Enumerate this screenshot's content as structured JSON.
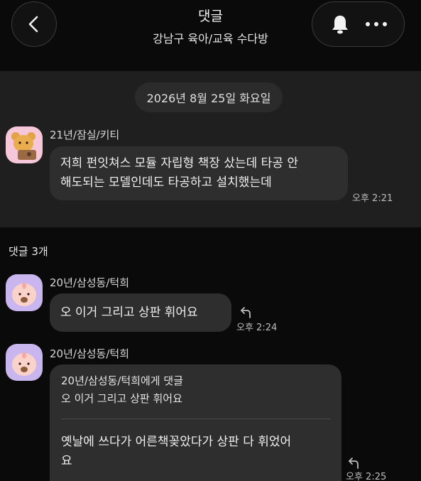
{
  "header": {
    "title": "댓글",
    "subtitle": "강남구 육아/교육 수다방",
    "icons": [
      "chevron-left-icon",
      "bell-icon",
      "more-icon"
    ]
  },
  "post": {
    "date": "2026년 8월 25일 화요일",
    "author": "21년/잠실/키티",
    "text_line1": "저희 펀잇쳐스 모듈 자립형 책장 샀는데 타공 안",
    "text_line2": "해도되는 모델인데도 타공하고 설치했는데",
    "time": "오후 2:21"
  },
  "comments_label": "댓글 3개",
  "comments": [
    {
      "author": "20년/삼성동/턱희",
      "text": "오 이거 그리고 상판 휘어요",
      "time": "오후 2:24"
    },
    {
      "author": "20년/삼성동/턱희",
      "quote_header": "20년/삼성동/턱희에게 댓글",
      "quote_text": "오 이거 그리고 상판 휘어요",
      "text_line1": "옛날에 쓰다가 어른책꽂았다가 상판 다 휘었어",
      "text_line2": "요",
      "time": "오후 2:25"
    }
  ],
  "colors": {
    "background": "#0a0a0a",
    "post_area": "#1f1f1f",
    "bubble": "#2e2e2e",
    "avatar_ryan": "#f6c6d9",
    "avatar_apeach": "#c9b6ef"
  }
}
